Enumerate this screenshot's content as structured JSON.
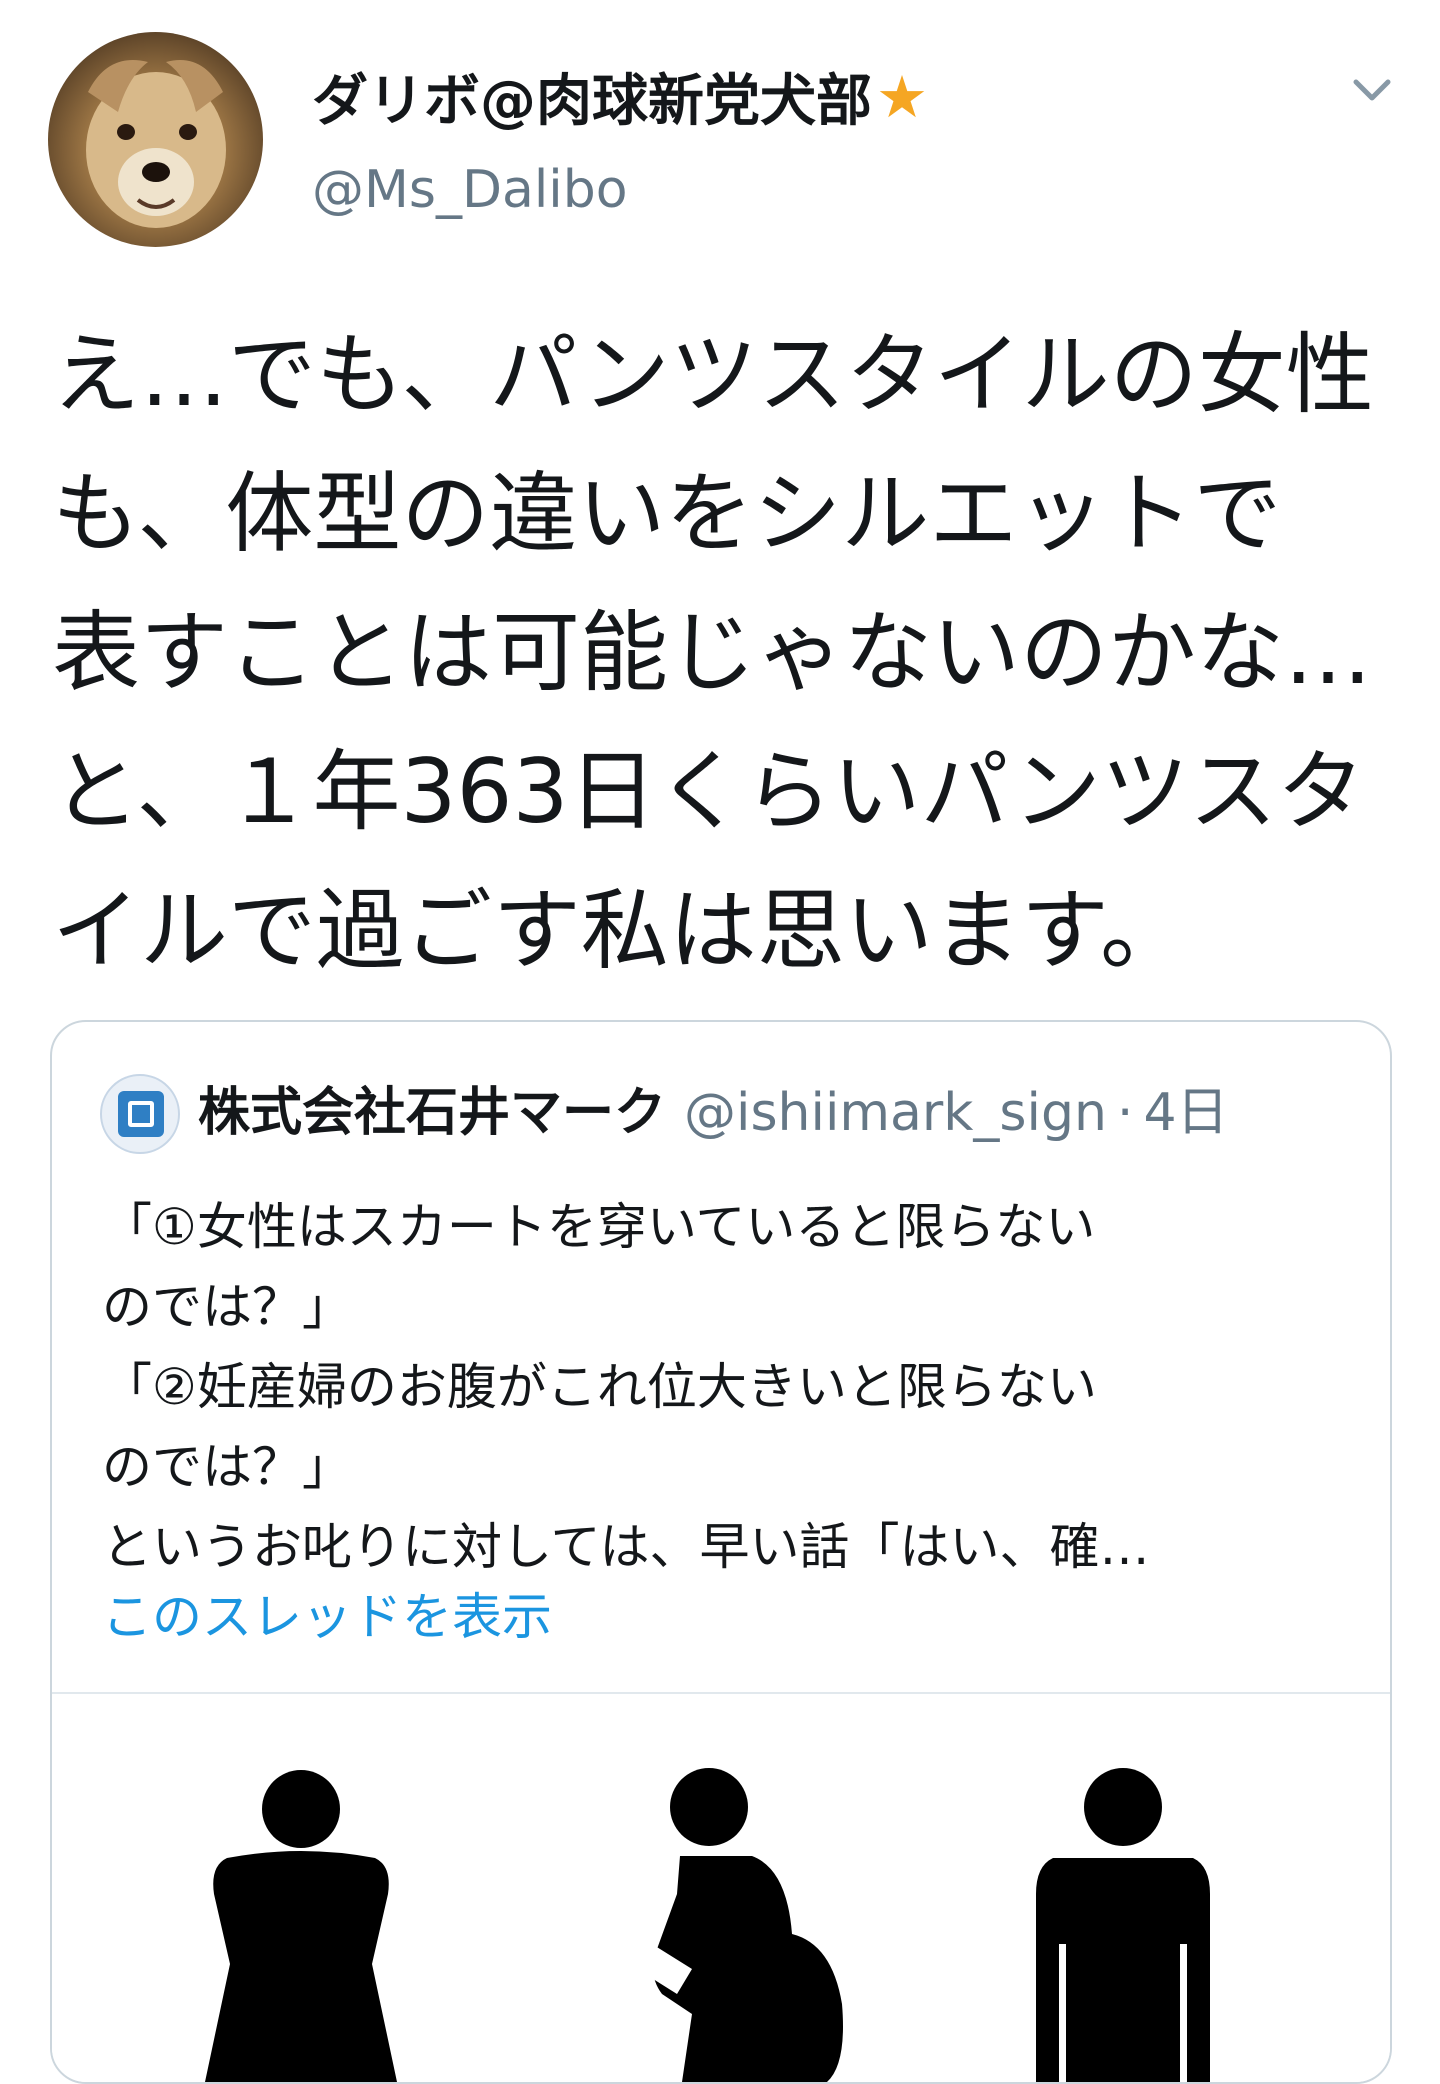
{
  "tweet": {
    "display_name": "ダリボ@肉球新党犬部",
    "handle": "@Ms_Dalibo",
    "text_lines": [
      "え…でも、パンツスタイルの女性",
      "も、体型の違いをシルエットで",
      "表すことは可能じゃないのかな…",
      "と、１年363日くらいパンツスタ",
      "イルで過ごす私は思います。"
    ]
  },
  "quote": {
    "name": "株式会社石井マーク",
    "handle": "@ishiimark_sign",
    "separator": "·",
    "time": "4日",
    "text_lines": [
      "「①女性はスカートを穿いていると限らない",
      "のでは？」",
      "「②妊産婦のお腹がこれ位大きいと限らない",
      "のでは？」",
      "というお叱りに対しては、早い話「はい、確…"
    ],
    "thread_link": "このスレッドを表示"
  },
  "icons": {
    "verified": "star-icon",
    "menu": "chevron-down-icon",
    "pictograms": [
      "woman-pictogram-icon",
      "pregnant-woman-pictogram-icon",
      "man-pictogram-icon"
    ]
  },
  "colors": {
    "link": "#1b95e0",
    "secondary_text": "#657786",
    "star": "#f5a623",
    "border": "#ccd6dd"
  }
}
